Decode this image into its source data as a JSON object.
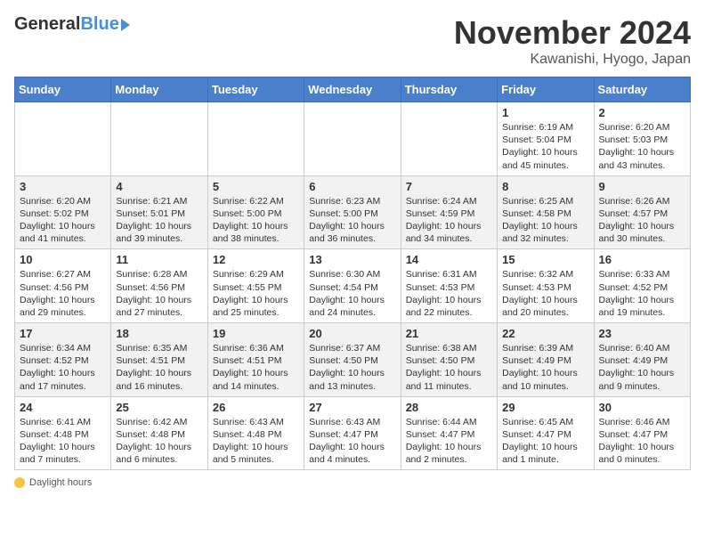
{
  "logo": {
    "general": "General",
    "blue": "Blue"
  },
  "title": "November 2024",
  "location": "Kawanishi, Hyogo, Japan",
  "days_of_week": [
    "Sunday",
    "Monday",
    "Tuesday",
    "Wednesday",
    "Thursday",
    "Friday",
    "Saturday"
  ],
  "legend": {
    "daylight_label": "Daylight hours"
  },
  "weeks": [
    [
      {
        "day": "",
        "info": ""
      },
      {
        "day": "",
        "info": ""
      },
      {
        "day": "",
        "info": ""
      },
      {
        "day": "",
        "info": ""
      },
      {
        "day": "",
        "info": ""
      },
      {
        "day": "1",
        "info": "Sunrise: 6:19 AM\nSunset: 5:04 PM\nDaylight: 10 hours and 45 minutes."
      },
      {
        "day": "2",
        "info": "Sunrise: 6:20 AM\nSunset: 5:03 PM\nDaylight: 10 hours and 43 minutes."
      }
    ],
    [
      {
        "day": "3",
        "info": "Sunrise: 6:20 AM\nSunset: 5:02 PM\nDaylight: 10 hours and 41 minutes."
      },
      {
        "day": "4",
        "info": "Sunrise: 6:21 AM\nSunset: 5:01 PM\nDaylight: 10 hours and 39 minutes."
      },
      {
        "day": "5",
        "info": "Sunrise: 6:22 AM\nSunset: 5:00 PM\nDaylight: 10 hours and 38 minutes."
      },
      {
        "day": "6",
        "info": "Sunrise: 6:23 AM\nSunset: 5:00 PM\nDaylight: 10 hours and 36 minutes."
      },
      {
        "day": "7",
        "info": "Sunrise: 6:24 AM\nSunset: 4:59 PM\nDaylight: 10 hours and 34 minutes."
      },
      {
        "day": "8",
        "info": "Sunrise: 6:25 AM\nSunset: 4:58 PM\nDaylight: 10 hours and 32 minutes."
      },
      {
        "day": "9",
        "info": "Sunrise: 6:26 AM\nSunset: 4:57 PM\nDaylight: 10 hours and 30 minutes."
      }
    ],
    [
      {
        "day": "10",
        "info": "Sunrise: 6:27 AM\nSunset: 4:56 PM\nDaylight: 10 hours and 29 minutes."
      },
      {
        "day": "11",
        "info": "Sunrise: 6:28 AM\nSunset: 4:56 PM\nDaylight: 10 hours and 27 minutes."
      },
      {
        "day": "12",
        "info": "Sunrise: 6:29 AM\nSunset: 4:55 PM\nDaylight: 10 hours and 25 minutes."
      },
      {
        "day": "13",
        "info": "Sunrise: 6:30 AM\nSunset: 4:54 PM\nDaylight: 10 hours and 24 minutes."
      },
      {
        "day": "14",
        "info": "Sunrise: 6:31 AM\nSunset: 4:53 PM\nDaylight: 10 hours and 22 minutes."
      },
      {
        "day": "15",
        "info": "Sunrise: 6:32 AM\nSunset: 4:53 PM\nDaylight: 10 hours and 20 minutes."
      },
      {
        "day": "16",
        "info": "Sunrise: 6:33 AM\nSunset: 4:52 PM\nDaylight: 10 hours and 19 minutes."
      }
    ],
    [
      {
        "day": "17",
        "info": "Sunrise: 6:34 AM\nSunset: 4:52 PM\nDaylight: 10 hours and 17 minutes."
      },
      {
        "day": "18",
        "info": "Sunrise: 6:35 AM\nSunset: 4:51 PM\nDaylight: 10 hours and 16 minutes."
      },
      {
        "day": "19",
        "info": "Sunrise: 6:36 AM\nSunset: 4:51 PM\nDaylight: 10 hours and 14 minutes."
      },
      {
        "day": "20",
        "info": "Sunrise: 6:37 AM\nSunset: 4:50 PM\nDaylight: 10 hours and 13 minutes."
      },
      {
        "day": "21",
        "info": "Sunrise: 6:38 AM\nSunset: 4:50 PM\nDaylight: 10 hours and 11 minutes."
      },
      {
        "day": "22",
        "info": "Sunrise: 6:39 AM\nSunset: 4:49 PM\nDaylight: 10 hours and 10 minutes."
      },
      {
        "day": "23",
        "info": "Sunrise: 6:40 AM\nSunset: 4:49 PM\nDaylight: 10 hours and 9 minutes."
      }
    ],
    [
      {
        "day": "24",
        "info": "Sunrise: 6:41 AM\nSunset: 4:48 PM\nDaylight: 10 hours and 7 minutes."
      },
      {
        "day": "25",
        "info": "Sunrise: 6:42 AM\nSunset: 4:48 PM\nDaylight: 10 hours and 6 minutes."
      },
      {
        "day": "26",
        "info": "Sunrise: 6:43 AM\nSunset: 4:48 PM\nDaylight: 10 hours and 5 minutes."
      },
      {
        "day": "27",
        "info": "Sunrise: 6:43 AM\nSunset: 4:47 PM\nDaylight: 10 hours and 4 minutes."
      },
      {
        "day": "28",
        "info": "Sunrise: 6:44 AM\nSunset: 4:47 PM\nDaylight: 10 hours and 2 minutes."
      },
      {
        "day": "29",
        "info": "Sunrise: 6:45 AM\nSunset: 4:47 PM\nDaylight: 10 hours and 1 minute."
      },
      {
        "day": "30",
        "info": "Sunrise: 6:46 AM\nSunset: 4:47 PM\nDaylight: 10 hours and 0 minutes."
      }
    ]
  ]
}
